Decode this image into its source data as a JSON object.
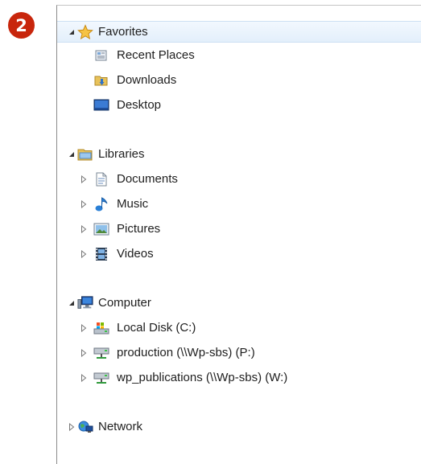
{
  "step_badge": "2",
  "tree": {
    "favorites": {
      "label": "Favorites",
      "icon": "star-icon",
      "expanded": true,
      "selected": true,
      "items": [
        {
          "label": "Recent Places",
          "icon": "recent-places-icon"
        },
        {
          "label": "Downloads",
          "icon": "downloads-folder-icon"
        },
        {
          "label": "Desktop",
          "icon": "desktop-icon"
        }
      ]
    },
    "libraries": {
      "label": "Libraries",
      "icon": "libraries-folder-icon",
      "expanded": true,
      "items": [
        {
          "label": "Documents",
          "icon": "document-icon"
        },
        {
          "label": "Music",
          "icon": "music-note-icon"
        },
        {
          "label": "Pictures",
          "icon": "picture-icon"
        },
        {
          "label": "Videos",
          "icon": "film-icon"
        }
      ]
    },
    "computer": {
      "label": "Computer",
      "icon": "computer-icon",
      "expanded": true,
      "items": [
        {
          "label": "Local Disk (C:)",
          "icon": "local-disk-icon"
        },
        {
          "label": "production (\\\\Wp-sbs) (P:)",
          "icon": "network-drive-icon"
        },
        {
          "label": "wp_publications (\\\\Wp-sbs) (W:)",
          "icon": "network-drive-icon"
        }
      ]
    },
    "network": {
      "label": "Network",
      "icon": "network-globe-icon",
      "expanded": false
    }
  },
  "colors": {
    "badge": "#c8260c",
    "selection": "#e3effb",
    "folder": "#e8c25a",
    "arrow": "#555555"
  }
}
